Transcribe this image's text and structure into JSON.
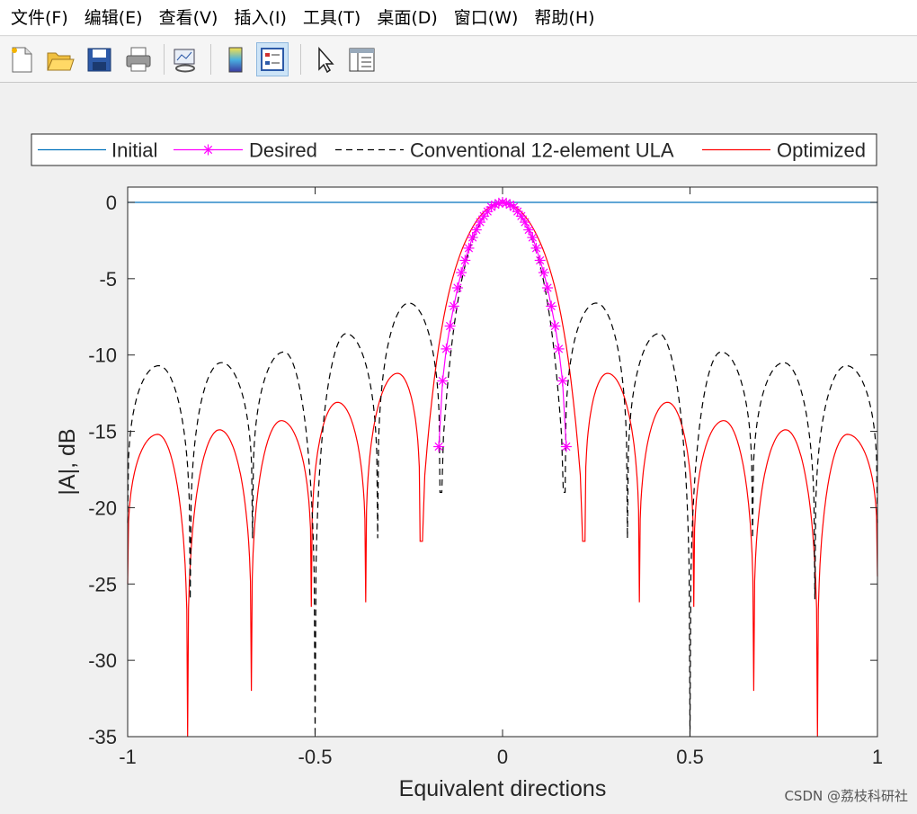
{
  "menu": [
    "文件(F)",
    "编辑(E)",
    "查看(V)",
    "插入(I)",
    "工具(T)",
    "桌面(D)",
    "窗口(W)",
    "帮助(H)"
  ],
  "toolbar": {
    "icons": [
      "new-file-icon",
      "open-folder-icon",
      "save-icon",
      "print-icon",
      "link-plot-icon",
      "colorbar-icon",
      "legend-icon",
      "pointer-icon",
      "property-editor-icon"
    ],
    "active": "legend-icon"
  },
  "colors": {
    "initial": "#0072bd",
    "desired": "#ff00ff",
    "conventional": "#000000",
    "optimized": "#ff0000"
  },
  "watermark": "CSDN @荔枝科研社",
  "chart_data": {
    "type": "line",
    "title": "",
    "xlabel": "Equivalent directions",
    "ylabel": "|A|, dB",
    "xlim": [
      -1,
      1
    ],
    "ylim": [
      -35,
      1
    ],
    "xticks": [
      -1,
      -0.5,
      0,
      0.5,
      1
    ],
    "xtick_labels": [
      "-1",
      "-0.5",
      "0",
      "0.5",
      "1"
    ],
    "yticks": [
      0,
      -5,
      -10,
      -15,
      -20,
      -25,
      -30,
      -35
    ],
    "ytick_labels": [
      "0",
      "-5",
      "-10",
      "-15",
      "-20",
      "-25",
      "-30",
      "-35"
    ],
    "grid": false,
    "legend_position": "top, horizontal",
    "series": [
      {
        "name": "Initial",
        "style": "solid",
        "x": [
          -1,
          1
        ],
        "y": [
          0,
          0
        ]
      },
      {
        "name": "Desired",
        "style": "solid-asterisk",
        "x": [
          -0.17,
          -0.16,
          -0.15,
          -0.14,
          -0.13,
          -0.12,
          -0.11,
          -0.1,
          -0.09,
          -0.08,
          -0.07,
          -0.06,
          -0.05,
          -0.04,
          -0.03,
          -0.02,
          -0.01,
          0,
          0.01,
          0.02,
          0.03,
          0.04,
          0.05,
          0.06,
          0.07,
          0.08,
          0.09,
          0.1,
          0.11,
          0.12,
          0.13,
          0.14,
          0.15,
          0.16,
          0.17
        ],
        "y": [
          -16.0,
          -11.7,
          -9.6,
          -8.1,
          -6.8,
          -5.6,
          -4.6,
          -3.8,
          -3.0,
          -2.3,
          -1.8,
          -1.3,
          -0.9,
          -0.6,
          -0.3,
          -0.15,
          -0.05,
          0,
          -0.05,
          -0.15,
          -0.3,
          -0.6,
          -0.9,
          -1.3,
          -1.8,
          -2.3,
          -3.0,
          -3.8,
          -4.6,
          -5.6,
          -6.8,
          -8.1,
          -9.6,
          -11.7,
          -16.0
        ]
      },
      {
        "name": "Conventional 12-element ULA",
        "style": "dashed",
        "nulls": [
          -1.0,
          -0.833,
          -0.667,
          -0.5,
          -0.333,
          -0.167,
          0.167,
          0.333,
          0.5,
          0.667,
          0.833,
          1.0
        ],
        "null_depths": [
          -21,
          -26,
          -22,
          -35,
          -22,
          -19,
          -19,
          -22,
          -35,
          -22,
          -26,
          -21
        ],
        "lobe_peaks": [
          {
            "x": -0.917,
            "y": -10.7
          },
          {
            "x": -0.75,
            "y": -10.5
          },
          {
            "x": -0.583,
            "y": -9.8
          },
          {
            "x": -0.417,
            "y": -8.6
          },
          {
            "x": -0.25,
            "y": -6.6
          },
          {
            "x": 0,
            "y": 0
          },
          {
            "x": 0.25,
            "y": -6.6
          },
          {
            "x": 0.417,
            "y": -8.6
          },
          {
            "x": 0.583,
            "y": -9.8
          },
          {
            "x": 0.75,
            "y": -10.5
          },
          {
            "x": 0.917,
            "y": -10.7
          }
        ]
      },
      {
        "name": "Optimized",
        "style": "solid",
        "nulls": [
          -1.0,
          -0.84,
          -0.67,
          -0.51,
          -0.365,
          -0.22,
          0.22,
          0.365,
          0.51,
          0.67,
          0.84,
          1.0
        ],
        "null_depths": [
          -25,
          -35,
          -32,
          -26.5,
          -26.2,
          -22.2,
          -22.2,
          -26.2,
          -26.5,
          -32,
          -35,
          -24.5
        ],
        "lobe_peaks": [
          {
            "x": -0.92,
            "y": -15.2
          },
          {
            "x": -0.755,
            "y": -14.9
          },
          {
            "x": -0.59,
            "y": -14.3
          },
          {
            "x": -0.44,
            "y": -13.1
          },
          {
            "x": -0.28,
            "y": -11.2
          },
          {
            "x": 0,
            "y": 0
          },
          {
            "x": 0.28,
            "y": -11.2
          },
          {
            "x": 0.44,
            "y": -13.1
          },
          {
            "x": 0.59,
            "y": -14.3
          },
          {
            "x": 0.755,
            "y": -14.9
          },
          {
            "x": 0.92,
            "y": -15.2
          }
        ]
      }
    ]
  }
}
